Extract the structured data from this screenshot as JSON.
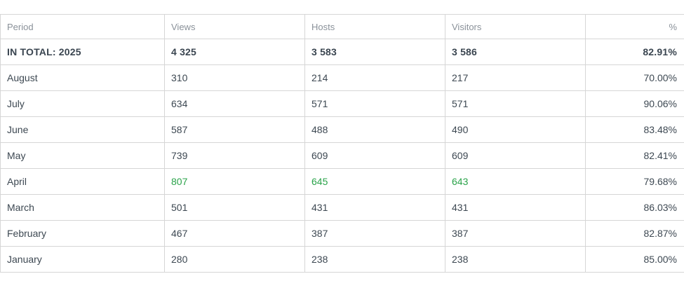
{
  "headers": {
    "period": "Period",
    "views": "Views",
    "hosts": "Hosts",
    "visitors": "Visitors",
    "percent": "%"
  },
  "total": {
    "label": "IN TOTAL: 2025",
    "views": "4 325",
    "hosts": "3 583",
    "visitors": "3 586",
    "percent": "82.91%"
  },
  "rows": [
    {
      "period": "August",
      "views": "310",
      "hosts": "214",
      "visitors": "217",
      "percent": "70.00%"
    },
    {
      "period": "July",
      "views": "634",
      "hosts": "571",
      "visitors": "571",
      "percent": "90.06%"
    },
    {
      "period": "June",
      "views": "587",
      "hosts": "488",
      "visitors": "490",
      "percent": "83.48%"
    },
    {
      "period": "May",
      "views": "739",
      "hosts": "609",
      "visitors": "609",
      "percent": "82.41%"
    },
    {
      "period": "April",
      "views": "807",
      "hosts": "645",
      "visitors": "643",
      "percent": "79.68%"
    },
    {
      "period": "March",
      "views": "501",
      "hosts": "431",
      "visitors": "431",
      "percent": "86.03%"
    },
    {
      "period": "February",
      "views": "467",
      "hosts": "387",
      "visitors": "387",
      "percent": "82.87%"
    },
    {
      "period": "January",
      "views": "280",
      "hosts": "238",
      "visitors": "238",
      "percent": "85.00%"
    }
  ],
  "colors": {
    "highlight": "#2aa34a"
  }
}
